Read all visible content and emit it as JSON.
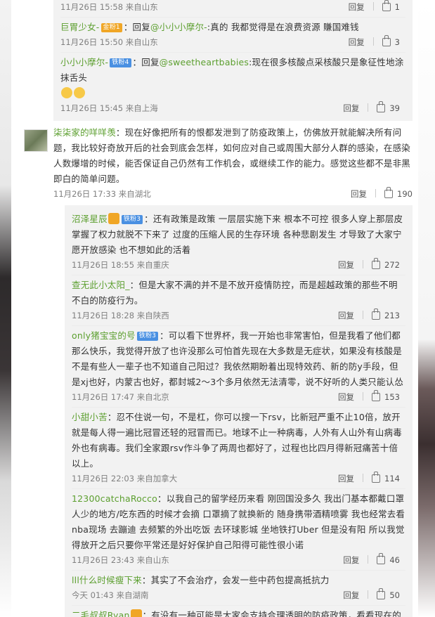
{
  "top_cut": {
    "text": "…  ……  …",
    "time": "11月26日 15:58 来自山东",
    "reply_label": "回复",
    "likes": "1"
  },
  "replies_a": [
    {
      "user": "巨胃少女-",
      "badge": "金粉1",
      "badge_color": "#f0a626",
      "text_prefix": "：回复",
      "mention": "@小小小摩尔-",
      "text": ":真的 我都觉得是在浪费资源 賺国难钱",
      "time": "11月26日 15:50 来自山东",
      "reply_label": "回复",
      "likes": "3"
    },
    {
      "user": "小小小摩尔-",
      "badge": "铁粉4",
      "badge_color": "#4a90e2",
      "text_prefix": "：回复",
      "mention": "@sweetheartbabies",
      "text": ":现在很多核酸点采核酸只是象征性地涂抹舌头",
      "time": "11月26日 15:45 来自上海",
      "reply_label": "回复",
      "likes": "39"
    }
  ],
  "main_comment": {
    "user": "柒柒家的咩咩羡",
    "text": "：现在好像把所有的恨都发泄到了防疫政策上，仿佛放开就能解决所有问题，我比较好奇放开后的社会到底会怎样，如何应对自己或周围大部分人群的感染，在感染人数爆增的时候，能否保证自己仍然有工作机会，或继续工作的能力。感觉这些都不是非黑即白的简单问题。",
    "time": "11月26日 17:33 来自湖北",
    "reply_label": "回复",
    "likes": "190"
  },
  "replies_b": [
    {
      "user": "沼泽星辰",
      "badge": "铁粉3",
      "text": "：还有政策是政策 一层层实施下来 根本不可控 很多人穿上那层皮掌握了权力就脱不下来了 过度的压缩人民的生存环境 各种悲剧发生 才导致了大家宁愿开放感染 也不想如此的活着",
      "time": "11月26日 18:55 来自重庆",
      "reply_label": "回复",
      "likes": "272"
    },
    {
      "user": "查无此小太阳_",
      "badge": "",
      "text": "：但是大家不满的并不是不放开疫情防控，而是超越政策的那些不明不白的防疫行为。",
      "time": "11月26日 18:28 来自陕西",
      "reply_label": "回复",
      "likes": "213"
    },
    {
      "user": "only猪宝宝的号",
      "badge": "铁粉3",
      "text": "：可以看下世界杯，我一开始也非常害怕，但是我看了他们都那么快乐，我觉得开放了也许没那么可怕首先现在大多数是无症状，如果没有核酸是不是有些人一辈子也不知道自己阳过？我依然期盼着出现特效药、新的防y手段，但是xj也好，内蒙古也好，都封城2～3个多月依然无法清零，说不好听的人类只能认怂",
      "time": "11月26日 17:47 来自北京",
      "reply_label": "回复",
      "likes": "153"
    },
    {
      "user": "小甜小苦",
      "badge": "",
      "text": "：忍不住说一句，不是杠，你可以搜一下rsv，比新冠严重不止10倍，放开就是每人得一遍比冠冒还轻的冠冒而已。地球不止一种病毒，人外有人山外有山病毒外也有病毒。我们全家跟rsv作斗争了两周也都好了，过程也比四月得新冠痛苦十倍以上。",
      "time": "11月26日 22:03 来自加拿大",
      "reply_label": "回复",
      "likes": "114"
    },
    {
      "user": "12300catchaRocco",
      "badge": "",
      "text": "：以我自己的留学经历来看 刚回国没多久 我出门基本都戴口罩 人少的地方/吃东西的时候才会摘 口罩摘了就换新的 随身携带酒精喷雾 我也经常去看nba现场 去蹦迪 去频繁的外出吃饭 去环球影城 坐地铁打Uber 但是没有阳 所以我觉得放开之后只要你平常还是好好保护自己阳得可能性很小诺",
      "time": "11月26日 23:43 来自山东",
      "reply_label": "回复",
      "likes": "46"
    },
    {
      "user": "lll什么时候瘦下来",
      "badge": "",
      "text": "：其实了不会治疗，会发一些中药包提高抵抗力",
      "time": "今天 01:43 来自湖南",
      "reply_label": "回复",
      "likes": "50"
    },
    {
      "user": "二毛叔叔Ryan",
      "badge": "",
      "text": "：有没有一种可能是大家会支持合理透明的防疫政策，看看现在的政府都是",
      "time": "",
      "reply_label": "",
      "likes": ""
    }
  ]
}
